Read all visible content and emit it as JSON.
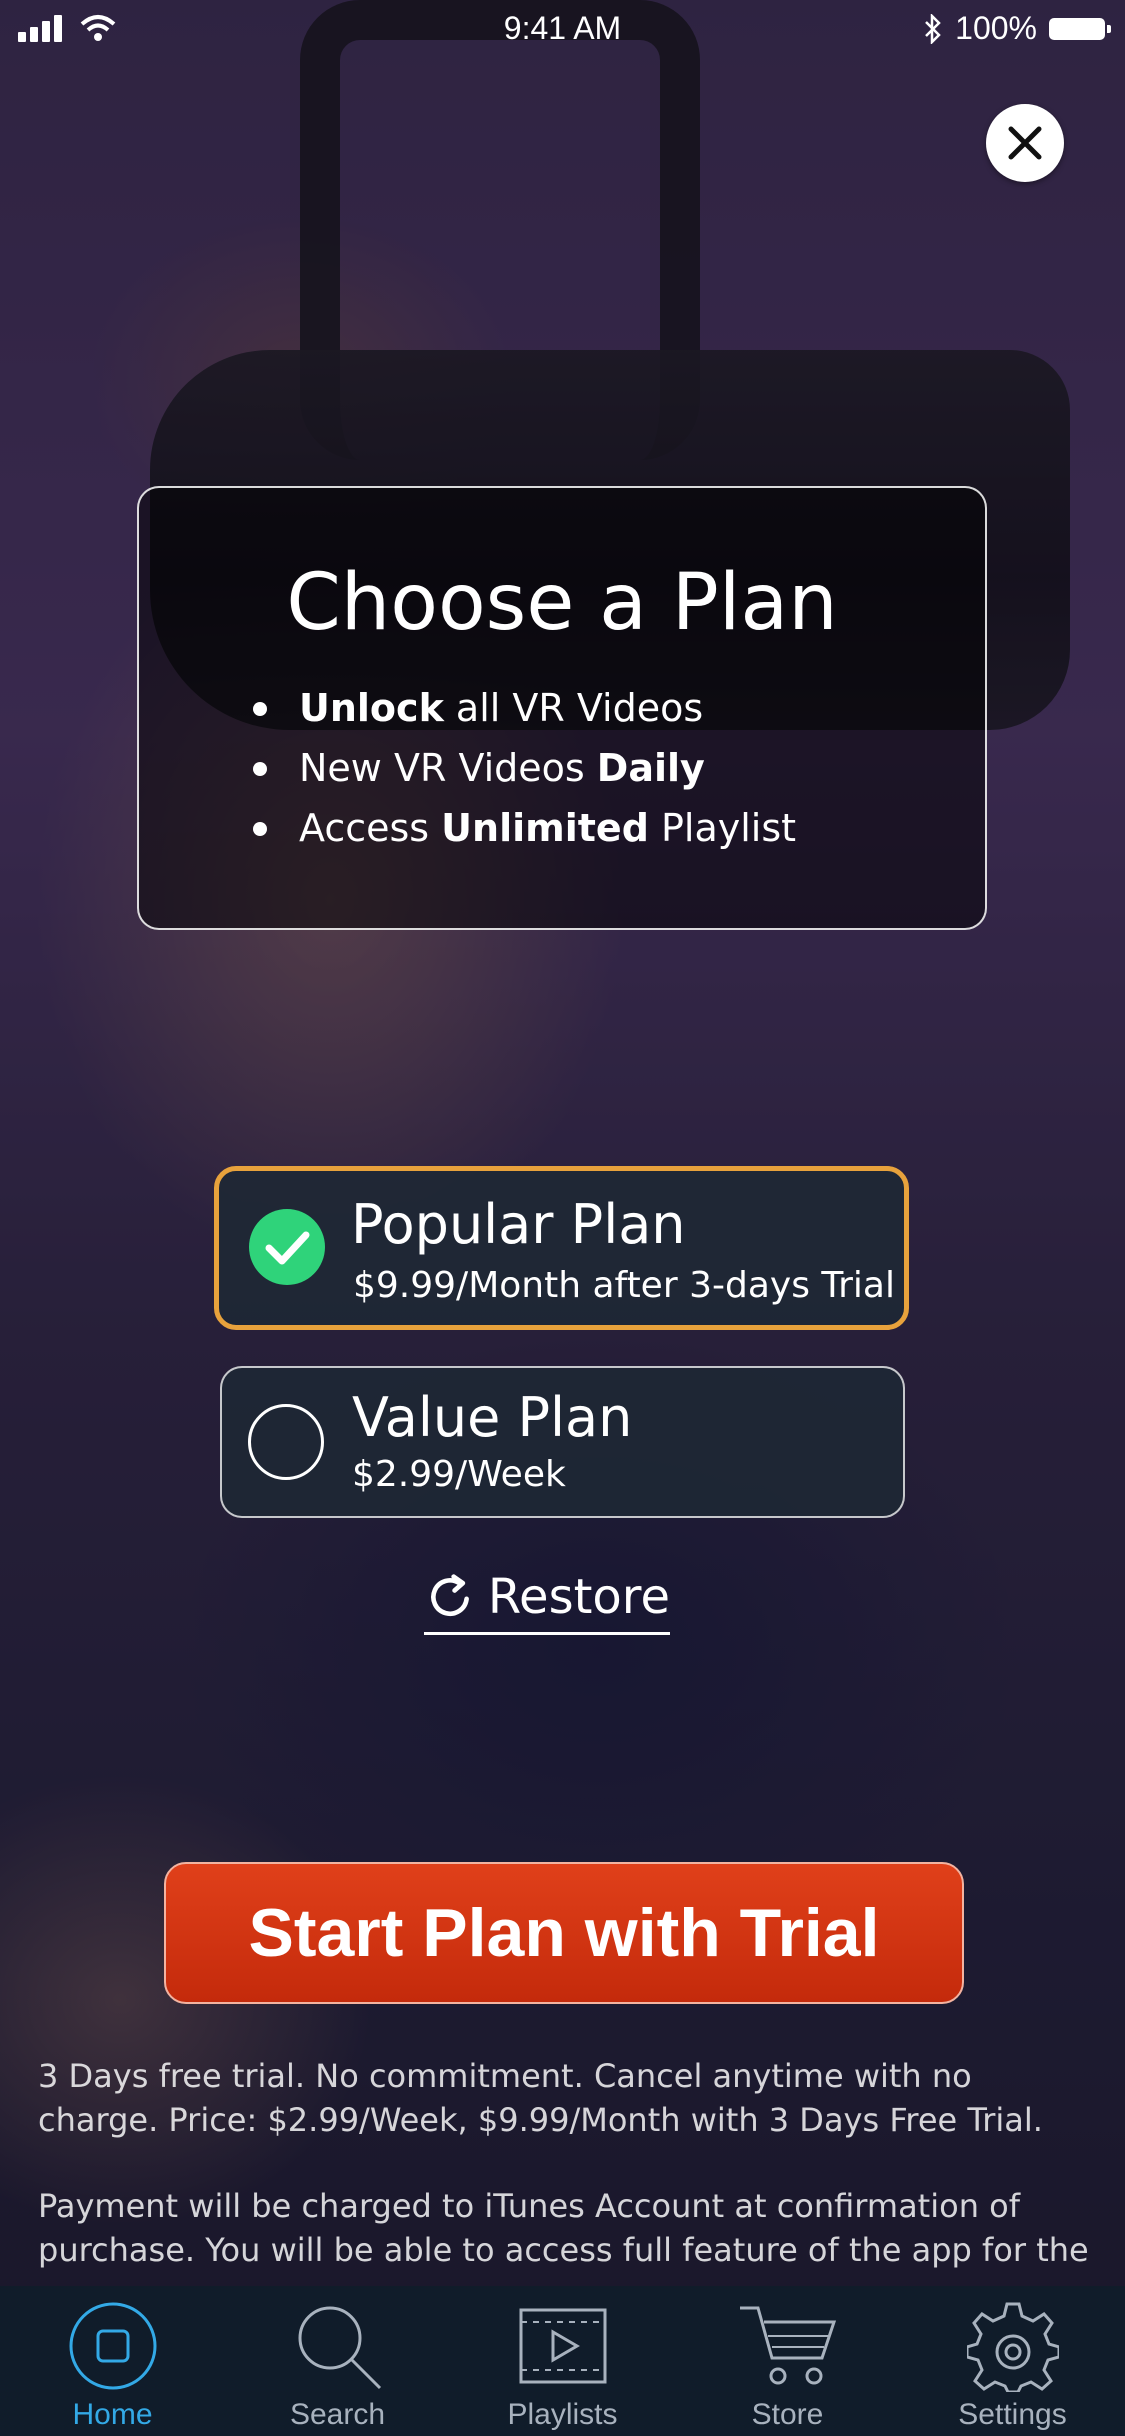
{
  "status_bar": {
    "time": "9:41 AM",
    "battery": "100%",
    "icons": [
      "signal-icon",
      "wifi-icon",
      "bluetooth-icon",
      "battery-icon"
    ]
  },
  "close": {
    "icon": "close-icon"
  },
  "plan_card": {
    "title": "Choose a Plan",
    "features": [
      {
        "bold": "Unlock",
        "rest": " all VR Videos"
      },
      {
        "pre": "New VR Videos ",
        "bold": "Daily"
      },
      {
        "pre": "Access ",
        "bold": "Unlimited",
        "rest": " Playlist"
      }
    ]
  },
  "options": [
    {
      "name": "Popular Plan",
      "price": "$9.99/Month after 3-days Trial",
      "selected": true
    },
    {
      "name": "Value Plan",
      "price": "$2.99/Week",
      "selected": false
    }
  ],
  "restore_label": "Restore",
  "cta_label": "Start Plan with Trial",
  "legal": {
    "p1": "3 Days free trial. No commitment. Cancel anytime with no charge. Price: $2.99/Week, $9.99/Month with 3 Days Free Trial.",
    "p2": "Payment will be charged to iTunes Account at confirmation of purchase. You will be able to access full feature of the app for the"
  },
  "tabs": [
    {
      "label": "Home",
      "icon": "home-icon",
      "active": true
    },
    {
      "label": "Search",
      "icon": "search-icon",
      "active": false
    },
    {
      "label": "Playlists",
      "icon": "playlists-icon",
      "active": false
    },
    {
      "label": "Store",
      "icon": "cart-icon",
      "active": false
    },
    {
      "label": "Settings",
      "icon": "gear-icon",
      "active": false
    }
  ],
  "colors": {
    "accent_selected": "#e8a23c",
    "check_green": "#2fd37a",
    "cta_red": "#d5361a",
    "tab_active": "#33a9e6",
    "tab_bar_bg": "#101c2a"
  }
}
